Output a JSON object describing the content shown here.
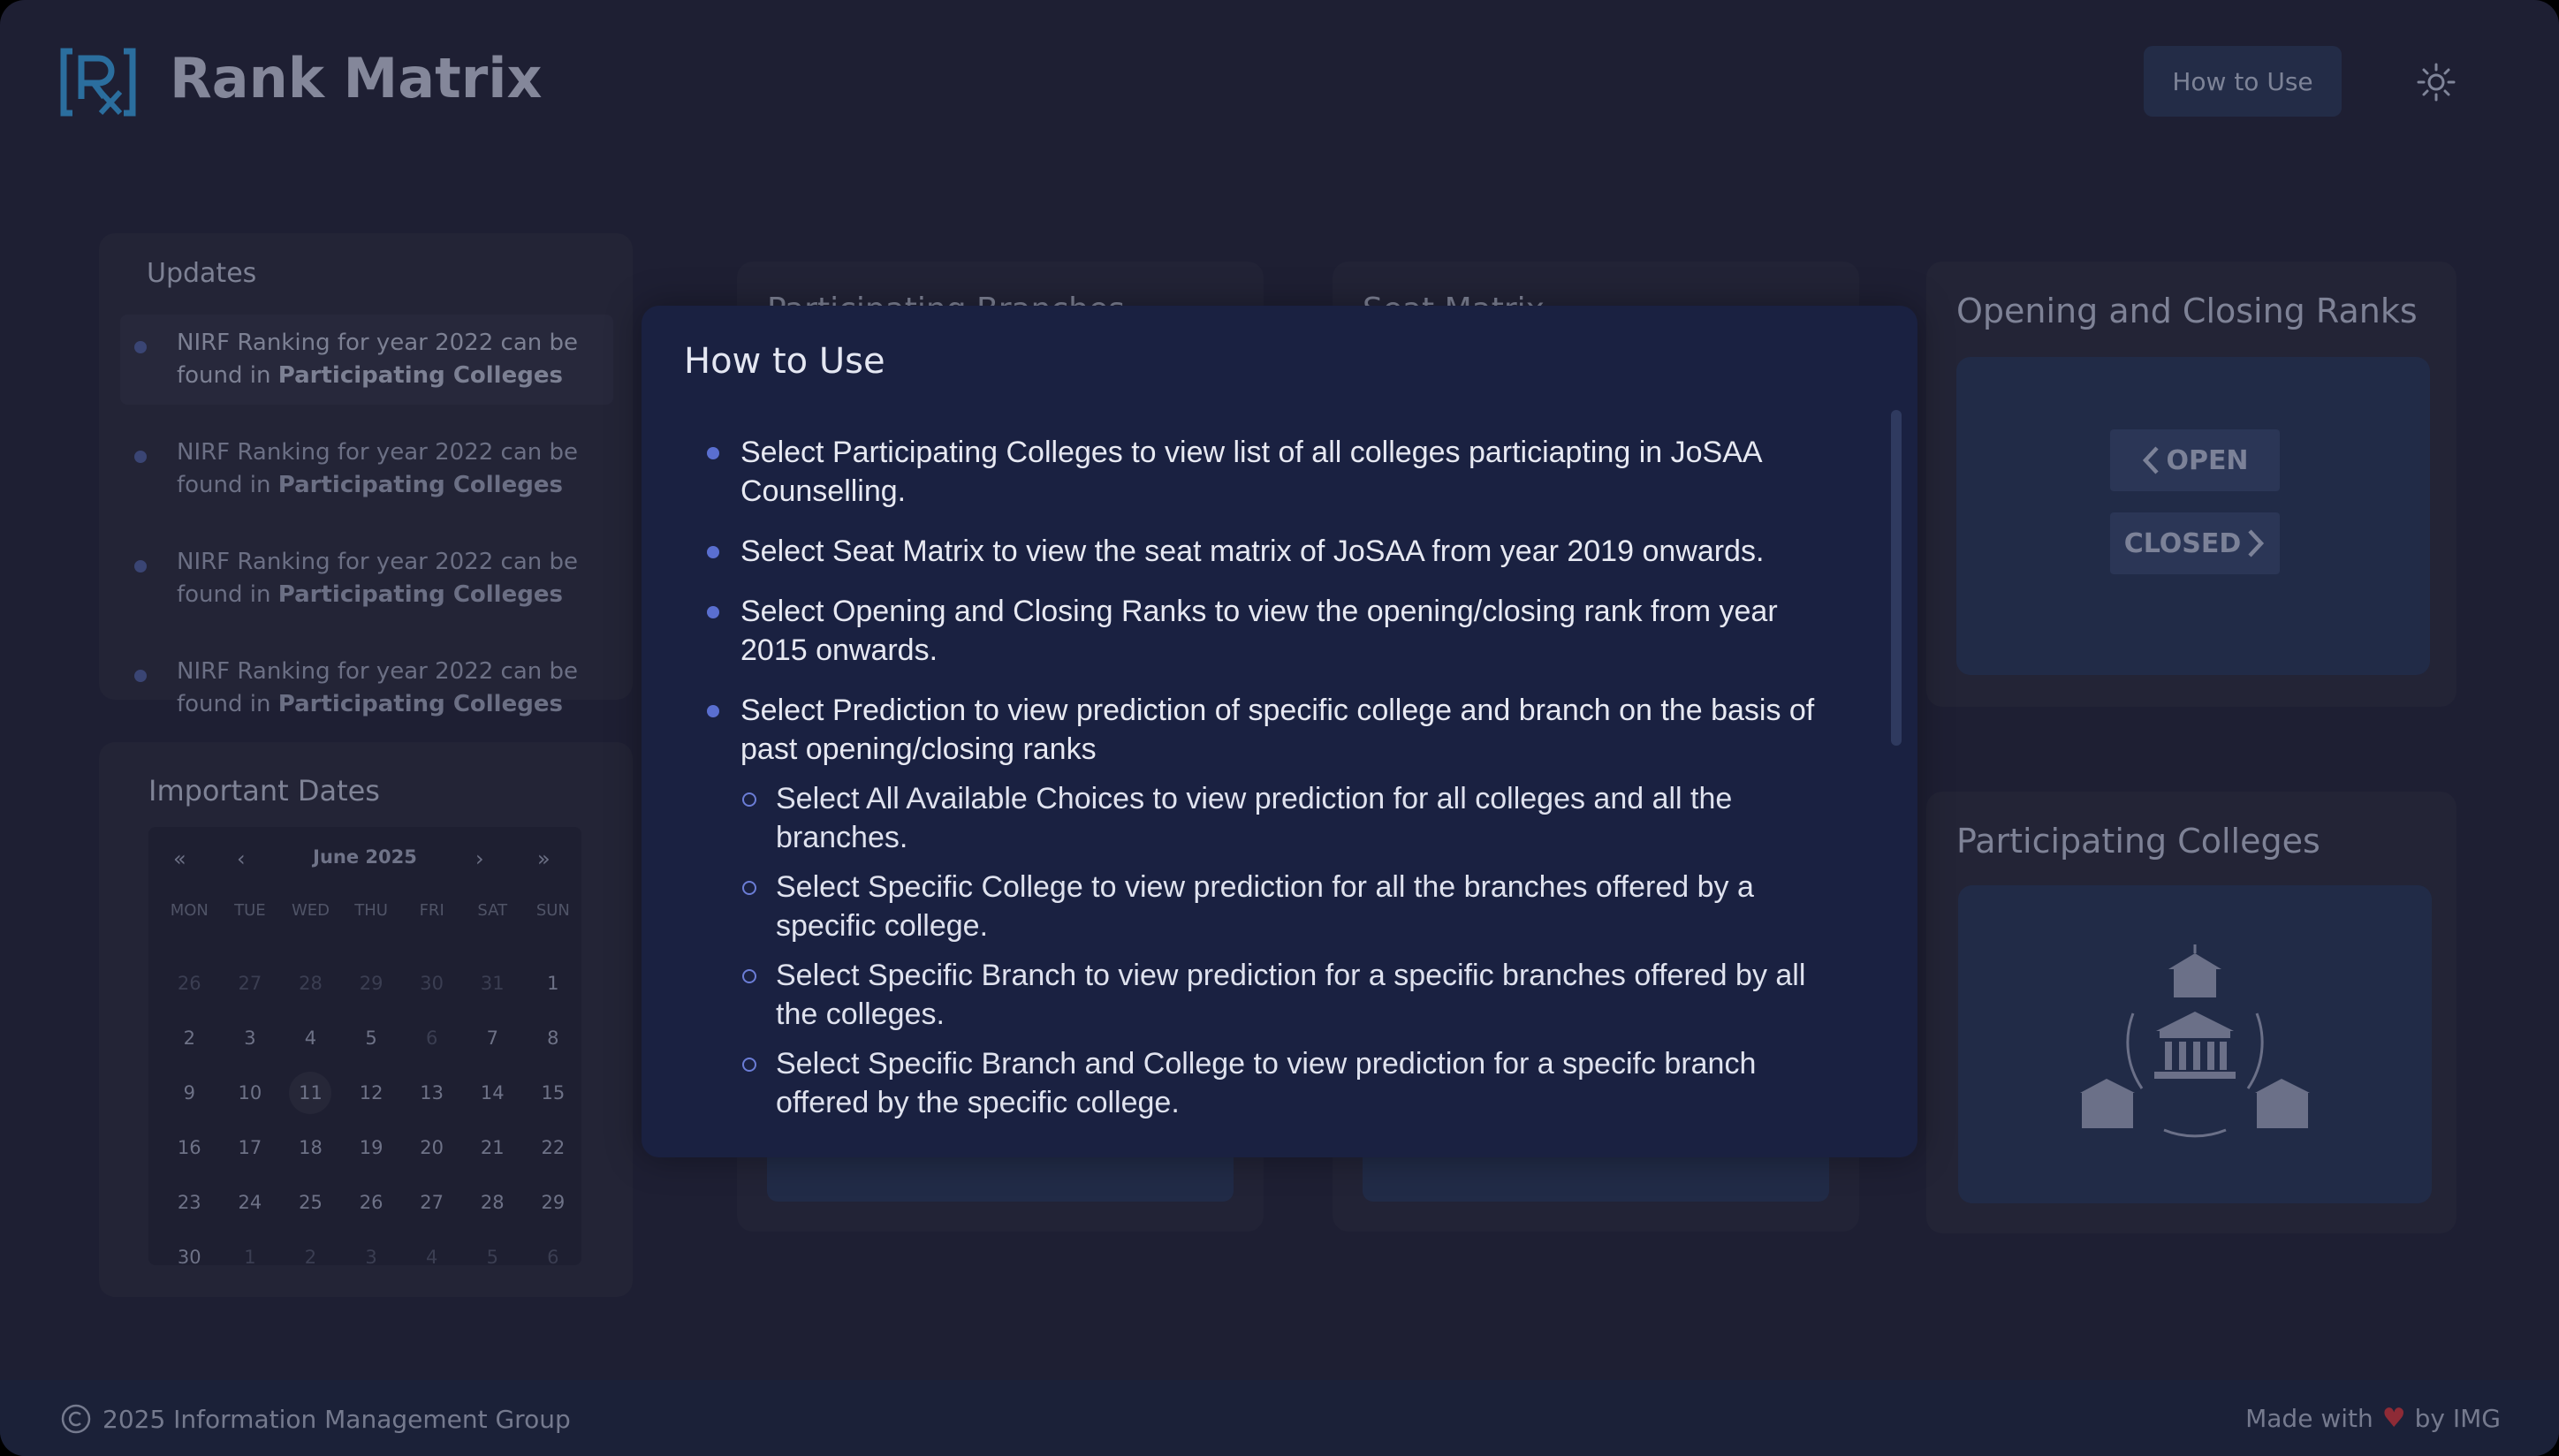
{
  "header": {
    "logo_alt": "Rx",
    "title": "Rank Matrix",
    "how_to_use_label": "How to Use",
    "theme_icon": "sun-icon"
  },
  "updates": {
    "heading": "Updates",
    "items": [
      {
        "text": "NIRF Ranking for year 2022 can be found in ",
        "link": "Participating Colleges"
      },
      {
        "text": "NIRF Ranking for year 2022 can be found in ",
        "link": "Participating Colleges"
      },
      {
        "text": "NIRF Ranking for year 2022 can be found in ",
        "link": "Participating Colleges"
      },
      {
        "text": "NIRF Ranking for year 2022 can be found in ",
        "link": "Participating Colleges"
      }
    ]
  },
  "dates": {
    "heading": "Important Dates",
    "nav": {
      "prev_year": "«",
      "prev_month": "‹",
      "next_month": "›",
      "next_year": "»"
    },
    "month_label": "June 2025",
    "weekdays": [
      "MON",
      "TUE",
      "WED",
      "THU",
      "FRI",
      "SAT",
      "SUN"
    ],
    "days": [
      {
        "d": "26",
        "m": true
      },
      {
        "d": "27",
        "m": true
      },
      {
        "d": "28",
        "m": true
      },
      {
        "d": "29",
        "m": true
      },
      {
        "d": "30",
        "m": true
      },
      {
        "d": "31",
        "m": true
      },
      {
        "d": "1",
        "m": false
      },
      {
        "d": "2",
        "m": false
      },
      {
        "d": "3",
        "m": false
      },
      {
        "d": "4",
        "m": false
      },
      {
        "d": "5",
        "m": false
      },
      {
        "d": "6",
        "m": true
      },
      {
        "d": "7",
        "m": false
      },
      {
        "d": "8",
        "m": false
      },
      {
        "d": "9",
        "m": false
      },
      {
        "d": "10",
        "m": false
      },
      {
        "d": "11",
        "m": false,
        "today": true
      },
      {
        "d": "12",
        "m": false
      },
      {
        "d": "13",
        "m": false
      },
      {
        "d": "14",
        "m": false
      },
      {
        "d": "15",
        "m": false
      },
      {
        "d": "16",
        "m": false
      },
      {
        "d": "17",
        "m": false
      },
      {
        "d": "18",
        "m": false
      },
      {
        "d": "19",
        "m": false
      },
      {
        "d": "20",
        "m": false
      },
      {
        "d": "21",
        "m": false
      },
      {
        "d": "22",
        "m": false
      },
      {
        "d": "23",
        "m": false
      },
      {
        "d": "24",
        "m": false
      },
      {
        "d": "25",
        "m": false
      },
      {
        "d": "26",
        "m": false
      },
      {
        "d": "27",
        "m": false
      },
      {
        "d": "28",
        "m": false
      },
      {
        "d": "29",
        "m": false
      },
      {
        "d": "30",
        "m": false
      },
      {
        "d": "1",
        "m": true
      },
      {
        "d": "2",
        "m": true
      },
      {
        "d": "3",
        "m": true
      },
      {
        "d": "4",
        "m": true
      },
      {
        "d": "5",
        "m": true
      },
      {
        "d": "6",
        "m": true
      }
    ]
  },
  "cards": {
    "participating_branches": "Participating Branches",
    "seat_matrix": "Seat Matrix",
    "opening_closing": "Opening and Closing Ranks",
    "open_label": "OPEN",
    "closed_label": "CLOSED",
    "participating_colleges": "Participating Colleges"
  },
  "modal": {
    "title": "How to Use",
    "bullets": [
      "Select Participating Colleges to view list of all colleges particiapting in JoSAA Counselling.",
      "Select Seat Matrix to view the seat matrix of JoSAA from year 2019 onwards.",
      "Select Opening and Closing Ranks to view the opening/closing rank from year 2015 onwards.",
      "Select Prediction to view prediction of specific college and branch on the basis of past opening/closing ranks"
    ],
    "sub_bullets": [
      "Select All Available Choices to view prediction for all colleges and all the branches.",
      "Select Specific College to view prediction for all the branches offered by a specific college.",
      "Select Specific Branch to view prediction for a specific branches offered by all the colleges.",
      "Select Specific Branch and College to view prediction for a specifc branch offered by the specific college."
    ]
  },
  "footer": {
    "copyright": "2025 Information Management Group",
    "made_with": "Made with",
    "by": "by IMG"
  },
  "colors": {
    "background": "#1e1f33",
    "modal": "#1a2141",
    "accent": "#5a6fd0",
    "logo": "#2b6e9e",
    "heart": "#8e2b36"
  }
}
